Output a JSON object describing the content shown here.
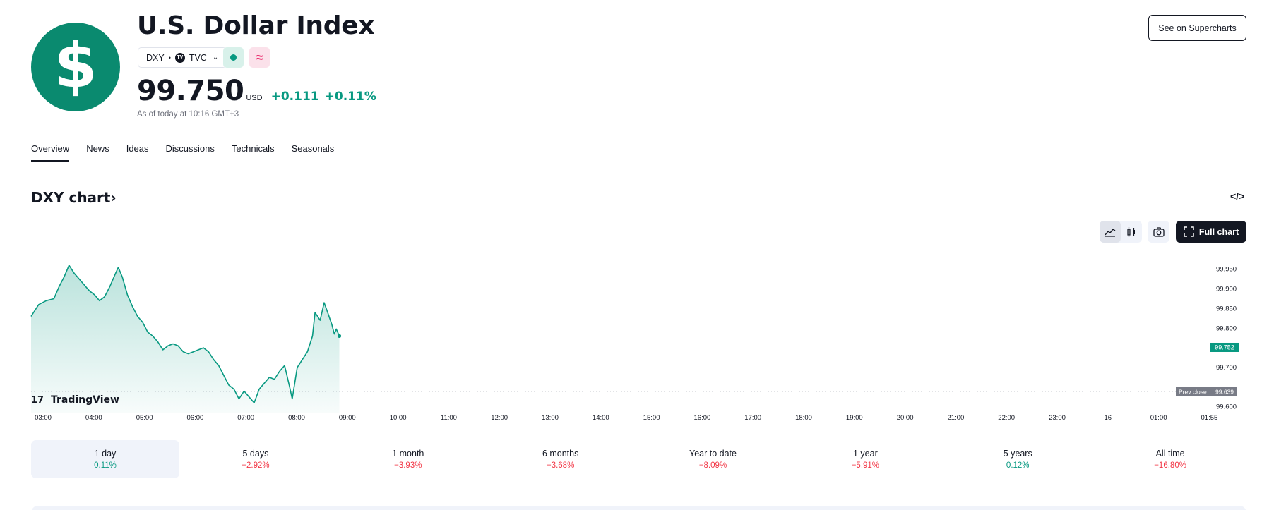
{
  "header": {
    "logo_symbol": "$",
    "title": "U.S. Dollar Index",
    "ticker": "DXY",
    "separator": "•",
    "exchange": "TVC",
    "exchange_mark": "TV",
    "price": "99.750",
    "currency": "USD",
    "change": "+0.111",
    "change_pct": "+0.11%",
    "as_of": "As of today at 10:16 GMT+3",
    "supercharts_button": "See on Supercharts",
    "market_status_icon": "green-dot",
    "pink_badge_icon": "approx-wave",
    "pink_badge_glyph": "≈"
  },
  "tabs": [
    "Overview",
    "News",
    "Ideas",
    "Discussions",
    "Technicals",
    "Seasonals"
  ],
  "chart_section": {
    "title": "DXY chart",
    "title_arrow": "›",
    "embed_icon": "</>",
    "full_chart_button": "Full chart",
    "brand": "TradingView",
    "brand_mark": "17"
  },
  "chart_data": {
    "type": "area",
    "symbol": "DXY",
    "x_ticks": [
      "03:00",
      "04:00",
      "05:00",
      "06:00",
      "07:00",
      "08:00",
      "09:00",
      "10:00",
      "11:00",
      "12:00",
      "13:00",
      "14:00",
      "15:00",
      "16:00",
      "17:00",
      "18:00",
      "19:00",
      "20:00",
      "21:00",
      "22:00",
      "23:00",
      "16",
      "01:00",
      "01:55"
    ],
    "y_ticks": [
      "99.950",
      "99.900",
      "99.850",
      "99.800",
      "99.700",
      "99.600"
    ],
    "ylim": [
      99.585,
      99.98
    ],
    "last_price_label": "99.752",
    "prev_close_label": "Prev close",
    "prev_close_value": "99.639",
    "prev_close": 99.639,
    "series": [
      {
        "points": [
          [
            0.0,
            99.83
          ],
          [
            0.15,
            99.86
          ],
          [
            0.3,
            99.87
          ],
          [
            0.45,
            99.875
          ],
          [
            0.55,
            99.905
          ],
          [
            0.65,
            99.93
          ],
          [
            0.75,
            99.96
          ],
          [
            0.85,
            99.94
          ],
          [
            0.95,
            99.925
          ],
          [
            1.05,
            99.91
          ],
          [
            1.15,
            99.895
          ],
          [
            1.25,
            99.885
          ],
          [
            1.35,
            99.87
          ],
          [
            1.45,
            99.88
          ],
          [
            1.55,
            99.905
          ],
          [
            1.65,
            99.935
          ],
          [
            1.72,
            99.955
          ],
          [
            1.8,
            99.93
          ],
          [
            1.9,
            99.885
          ],
          [
            2.0,
            99.855
          ],
          [
            2.1,
            99.83
          ],
          [
            2.2,
            99.815
          ],
          [
            2.3,
            99.79
          ],
          [
            2.4,
            99.78
          ],
          [
            2.5,
            99.765
          ],
          [
            2.6,
            99.745
          ],
          [
            2.7,
            99.755
          ],
          [
            2.8,
            99.76
          ],
          [
            2.9,
            99.755
          ],
          [
            3.0,
            99.74
          ],
          [
            3.1,
            99.735
          ],
          [
            3.2,
            99.74
          ],
          [
            3.3,
            99.745
          ],
          [
            3.4,
            99.75
          ],
          [
            3.5,
            99.74
          ],
          [
            3.6,
            99.72
          ],
          [
            3.7,
            99.705
          ],
          [
            3.8,
            99.68
          ],
          [
            3.9,
            99.655
          ],
          [
            4.0,
            99.645
          ],
          [
            4.1,
            99.62
          ],
          [
            4.2,
            99.64
          ],
          [
            4.3,
            99.625
          ],
          [
            4.4,
            99.61
          ],
          [
            4.5,
            99.645
          ],
          [
            4.6,
            99.66
          ],
          [
            4.7,
            99.675
          ],
          [
            4.8,
            99.67
          ],
          [
            4.9,
            99.69
          ],
          [
            5.0,
            99.705
          ],
          [
            5.1,
            99.65
          ],
          [
            5.15,
            99.62
          ],
          [
            5.25,
            99.7
          ],
          [
            5.35,
            99.72
          ],
          [
            5.45,
            99.74
          ],
          [
            5.55,
            99.78
          ],
          [
            5.6,
            99.84
          ],
          [
            5.7,
            99.82
          ],
          [
            5.78,
            99.865
          ],
          [
            5.85,
            99.84
          ],
          [
            5.93,
            99.81
          ],
          [
            5.98,
            99.785
          ],
          [
            6.02,
            99.798
          ],
          [
            6.08,
            99.78
          ]
        ]
      }
    ],
    "grid": false
  },
  "periods": [
    {
      "label": "1 day",
      "value": "0.11%",
      "dir": "up",
      "active": true
    },
    {
      "label": "5 days",
      "value": "−2.92%",
      "dir": "down",
      "active": false
    },
    {
      "label": "1 month",
      "value": "−3.93%",
      "dir": "down",
      "active": false
    },
    {
      "label": "6 months",
      "value": "−3.68%",
      "dir": "down",
      "active": false
    },
    {
      "label": "Year to date",
      "value": "−8.09%",
      "dir": "down",
      "active": false
    },
    {
      "label": "1 year",
      "value": "−5.91%",
      "dir": "down",
      "active": false
    },
    {
      "label": "5 years",
      "value": "0.12%",
      "dir": "up",
      "active": false
    },
    {
      "label": "All time",
      "value": "−16.80%",
      "dir": "down",
      "active": false
    }
  ],
  "colors": {
    "accent_green": "#089981",
    "accent_red": "#f23645",
    "logo_bg": "#0a8a6f"
  }
}
